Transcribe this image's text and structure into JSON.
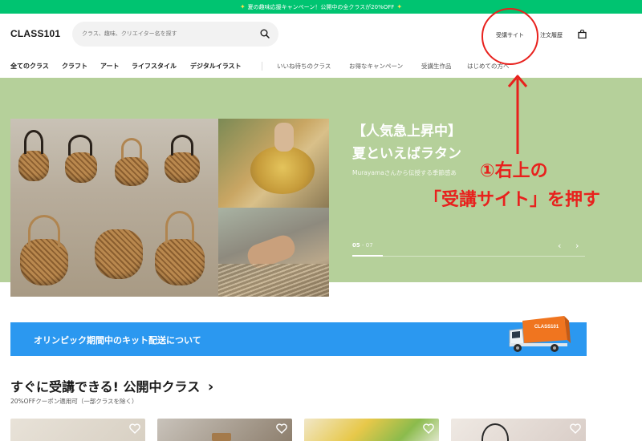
{
  "top_banner": {
    "star": "✦",
    "text": "夏の趣味応援キャンペーン！公開中の全クラスが20%OFF"
  },
  "header": {
    "logo": "CLASS101",
    "search_placeholder": "クラス、趣味、クリエイター名を探す",
    "links": {
      "course_site": "受講サイト",
      "order_history": "注文履歴"
    }
  },
  "nav": {
    "primary": [
      "全てのクラス",
      "クラフト",
      "アート",
      "ライフスタイル",
      "デジタルイラスト"
    ],
    "secondary": [
      "いいね待ちのクラス",
      "お得なキャンペーン",
      "受講生作品",
      "はじめての方へ"
    ]
  },
  "hero": {
    "title_line1": "【人気急上昇中】",
    "title_line2": "夏といえばラタン",
    "subtitle": "Murayamaさんから伝授する季節感あ",
    "pager_current": "05",
    "pager_separator": " - ",
    "pager_total": "07",
    "prev": "‹",
    "next": "›"
  },
  "annotation": {
    "line1": "①右上の",
    "line2": "「受講サイト」を押す",
    "color": "#e8211d"
  },
  "notice": {
    "text": "オリンピック期間中のキット配送について",
    "truck_label": "CLASS101"
  },
  "section": {
    "title": "すぐに受講できる! 公開中クラス",
    "chevron": "›",
    "subtitle": "20%OFFクーポン適用可（一部クラスを除く）"
  },
  "colors": {
    "brand_green": "#00c471",
    "hero_bg": "#b5d09a",
    "notice_blue": "#2b98f0"
  },
  "icons": {
    "search": "search-icon",
    "cart": "shopping-bag-icon",
    "heart": "heart-icon"
  }
}
